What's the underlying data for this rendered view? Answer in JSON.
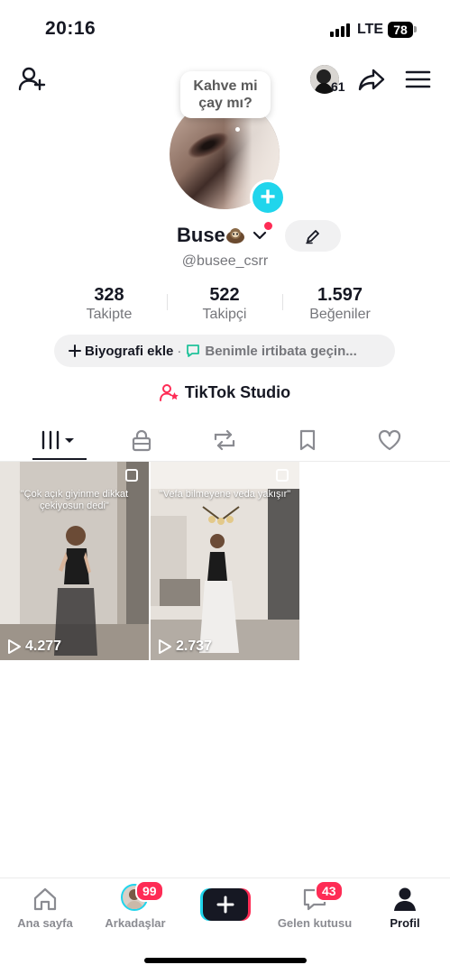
{
  "status": {
    "time": "20:16",
    "network": "LTE",
    "battery": "78"
  },
  "header": {
    "friends_count": "61",
    "icons": [
      "add-friend-icon",
      "share-icon",
      "menu-icon"
    ]
  },
  "profile": {
    "note": "Kahve mi\nçay mı?",
    "display_name": "Buse",
    "username": "@busee_csrr"
  },
  "stats": [
    {
      "value": "328",
      "label": "Takipte"
    },
    {
      "value": "522",
      "label": "Takipçi"
    },
    {
      "value": "1.597",
      "label": "Beğeniler"
    }
  ],
  "bio": {
    "add_label": "Biyografi ekle",
    "separator": "·",
    "contact_label": "Benimle irtibata geçin..."
  },
  "studio": {
    "label": "TikTok Studio"
  },
  "tabs": [
    "videos-tab",
    "private-tab",
    "reposts-tab",
    "saved-tab",
    "liked-tab"
  ],
  "videos": [
    {
      "caption": "\"Çok açık giyinme dikkat\nçekiyosun dedi\"",
      "views": "4.277"
    },
    {
      "caption": "\"Vefa bilmeyene veda yakışır\"",
      "views": "2.737"
    }
  ],
  "nav": {
    "home": "Ana sayfa",
    "friends": "Arkadaşlar",
    "friends_badge": "99",
    "inbox": "Gelen kutusu",
    "inbox_badge": "43",
    "profile": "Profil"
  },
  "colors": {
    "accent": "#fe2c55",
    "story_add": "#20d5ec",
    "contact_icon": "#1fc29a"
  }
}
